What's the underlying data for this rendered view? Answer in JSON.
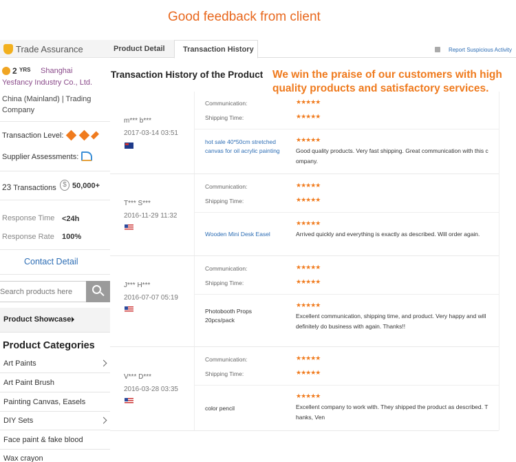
{
  "banner": {
    "title": "Good feedback from client"
  },
  "sidebar": {
    "trade_assurance": "Trade Assurance",
    "years_num": "2",
    "years_label": "YRS",
    "city": "Shanghai",
    "company": "Yesfancy Industry Co., Ltd.",
    "location": "China (Mainland) | Trading Company",
    "transaction_level_label": "Transaction Level:",
    "supplier_assessments_label": "Supplier Assessments:",
    "transactions_count": "23",
    "transactions_label": "Transactions",
    "transactions_amount": "50,000+",
    "response_time_label": "Response Time",
    "response_time_value": "<24h",
    "response_rate_label": "Response Rate",
    "response_rate_value": "100%",
    "contact_detail": "Contact Detail",
    "search_placeholder": "Search products here",
    "product_showcase": "Product Showcase",
    "product_categories_title": "Product Categories",
    "categories": [
      {
        "label": "Art Paints",
        "has_submenu": true
      },
      {
        "label": "Art Paint Brush",
        "has_submenu": false
      },
      {
        "label": "Painting Canvas, Easels",
        "has_submenu": false
      },
      {
        "label": "DIY Sets",
        "has_submenu": true
      },
      {
        "label": "Face paint & fake blood",
        "has_submenu": false
      },
      {
        "label": "Wax crayon",
        "has_submenu": false
      }
    ]
  },
  "tabs": {
    "product_detail": "Product Detail",
    "transaction_history": "Transaction History",
    "report": "Report Suspicious Activity"
  },
  "main": {
    "title": "Transaction History of the Product",
    "praise": "We win the praise of our customers with high quality products and satisfactory services.",
    "communication_label": "Communication:",
    "shipping_label": "Shipping Time:",
    "stars": "★★★★★",
    "reviews": [
      {
        "name": "m*** b***",
        "date": "2017-03-14 03:51",
        "country": "AU",
        "product": "hot sale 40*50cm stretched canvas for oil acrylic painting",
        "text": "Good quality products. Very fast shipping. Great communication with this company."
      },
      {
        "name": "T*** S***",
        "date": "2016-11-29 11:32",
        "country": "US",
        "product": "Wooden Mini Desk Easel",
        "text": "Arrived quickly and everything is exactly as described. Will order again."
      },
      {
        "name": "J*** H***",
        "date": "2016-07-07 05:19",
        "country": "US",
        "product": "Photobooth Props 20pcs/pack",
        "text": "Excellent communication, shipping time, and product. Very happy and will definitely do business with again. Thanks!!"
      },
      {
        "name": "V*** D***",
        "date": "2016-03-28 03:35",
        "country": "US",
        "product": "color pencil",
        "text": "Excellent company to work with. They shipped the product as described. Thanks, Ven"
      }
    ]
  },
  "colors": {
    "accent_orange": "#ef7a1d",
    "link_blue": "#2b6cb4",
    "star_orange": "#f07b1e"
  }
}
